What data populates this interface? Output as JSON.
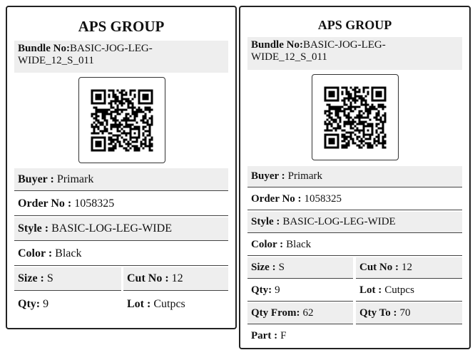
{
  "cards": [
    {
      "title": "APS GROUP",
      "bundle_label": "Bundle No:",
      "bundle_value": "BASIC-JOG-LEG-WIDE_12_S_011",
      "buyer_label": "Buyer :",
      "buyer_value": "Primark",
      "order_label": "Order No :",
      "order_value": "1058325",
      "style_label": "Style :",
      "style_value": "BASIC-LOG-LEG-WIDE",
      "color_label": "Color :",
      "color_value": "Black",
      "size_label": "Size :",
      "size_value": "S",
      "cut_label": "Cut No :",
      "cut_value": "12",
      "qty_label": "Qty:",
      "qty_value": "9",
      "lot_label": "Lot :",
      "lot_value": "Cutpcs"
    },
    {
      "title": "APS GROUP",
      "bundle_label": "Bundle No:",
      "bundle_value": "BASIC-JOG-LEG-WIDE_12_S_011",
      "buyer_label": "Buyer :",
      "buyer_value": "Primark",
      "order_label": "Order No :",
      "order_value": "1058325",
      "style_label": "Style :",
      "style_value": "BASIC-LOG-LEG-WIDE",
      "color_label": "Color :",
      "color_value": "Black",
      "size_label": "Size :",
      "size_value": "S",
      "cut_label": "Cut No :",
      "cut_value": "12",
      "qty_label": "Qty:",
      "qty_value": "9",
      "lot_label": "Lot :",
      "lot_value": "Cutpcs",
      "qty_from_label": "Qty From:",
      "qty_from_value": "62",
      "qty_to_label": "Qty To :",
      "qty_to_value": "70",
      "part_label": "Part :",
      "part_value": "F"
    }
  ],
  "colors": {
    "shade": "#eeeeee",
    "border": "#222222"
  },
  "icons": {
    "qr": "qr-code-icon"
  }
}
